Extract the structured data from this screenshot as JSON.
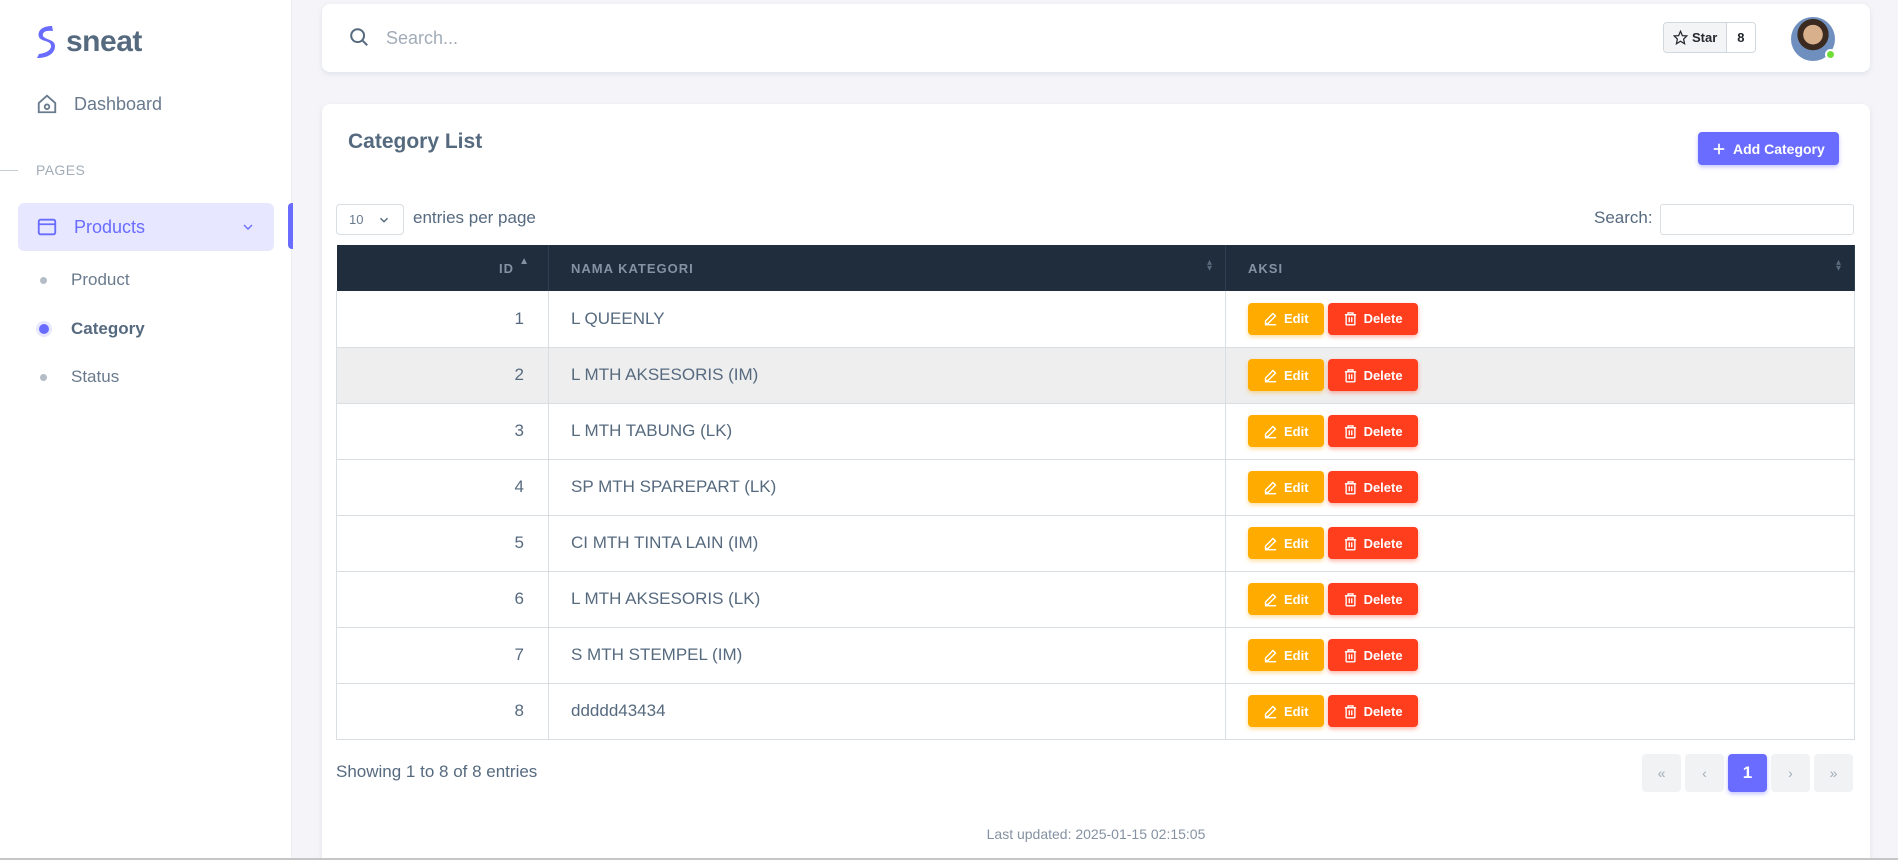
{
  "brand": {
    "name": "sneat"
  },
  "sidebar": {
    "dashboard_label": "Dashboard",
    "section_header": "PAGES",
    "products_label": "Products",
    "sub_items": [
      {
        "label": "Product"
      },
      {
        "label": "Category"
      },
      {
        "label": "Status"
      }
    ]
  },
  "navbar": {
    "search_placeholder": "Search...",
    "star_label": "Star",
    "star_count": "8"
  },
  "card": {
    "title": "Category List",
    "add_label": "Add Category",
    "length_value": "10",
    "length_label": "entries per page",
    "filter_label": "Search:"
  },
  "table": {
    "headers": [
      "ID",
      "NAMA KATEGORI",
      "AKSI"
    ],
    "edit_label": "Edit",
    "delete_label": "Delete",
    "rows": [
      {
        "id": "1",
        "name": "L QUEENLY"
      },
      {
        "id": "2",
        "name": "L MTH AKSESORIS (IM)"
      },
      {
        "id": "3",
        "name": "L MTH TABUNG (LK)"
      },
      {
        "id": "4",
        "name": "SP MTH SPAREPART (LK)"
      },
      {
        "id": "5",
        "name": "CI MTH TINTA LAIN (IM)"
      },
      {
        "id": "6",
        "name": "L MTH AKSESORIS (LK)"
      },
      {
        "id": "7",
        "name": "S MTH STEMPEL (IM)"
      },
      {
        "id": "8",
        "name": "ddddd43434"
      }
    ]
  },
  "footer": {
    "info": "Showing 1 to 8 of 8 entries",
    "pager": {
      "first": "«",
      "prev": "‹",
      "current": "1",
      "next": "›",
      "last": "»"
    },
    "last_updated": "Last updated: 2025-01-15 02:15:05"
  },
  "colors": {
    "primary": "#696cff",
    "warning": "#ffab00",
    "danger": "#ff3e1d",
    "table_header": "#1f2d3d"
  }
}
